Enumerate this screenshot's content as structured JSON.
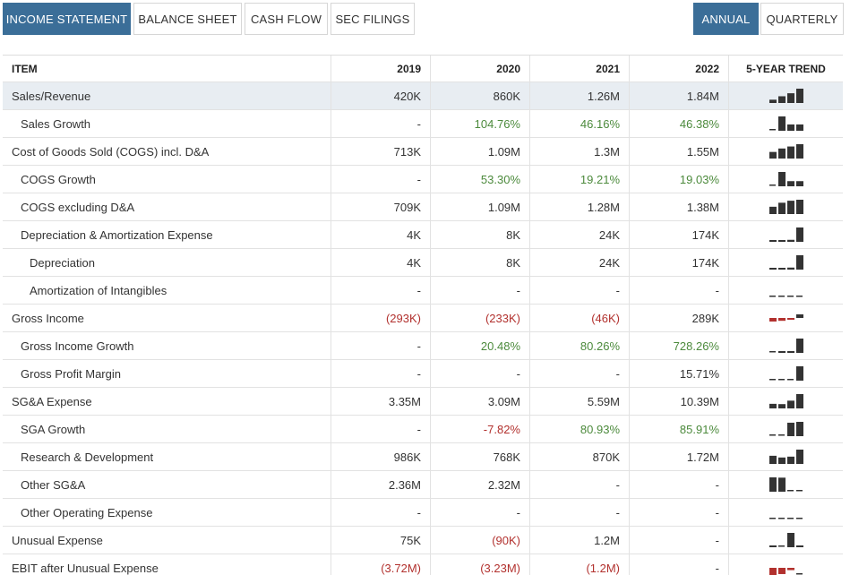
{
  "tabs": [
    {
      "label": "INCOME STATEMENT",
      "active": true
    },
    {
      "label": "BALANCE SHEET",
      "active": false
    },
    {
      "label": "CASH FLOW",
      "active": false
    },
    {
      "label": "SEC FILINGS",
      "active": false
    }
  ],
  "period_tabs": [
    {
      "label": "ANNUAL",
      "active": true
    },
    {
      "label": "QUARTERLY",
      "active": false
    }
  ],
  "table": {
    "header": [
      "ITEM",
      "2019",
      "2020",
      "2021",
      "2022",
      "5-YEAR TREND"
    ],
    "rows": [
      {
        "label": "Sales/Revenue",
        "indent": 0,
        "values": [
          "420K",
          "860K",
          "1.26M",
          "1.84M"
        ],
        "tone": [
          "",
          "",
          "",
          ""
        ],
        "trend": [
          0.23,
          0.47,
          0.68,
          1.0
        ]
      },
      {
        "label": "Sales Growth",
        "indent": 1,
        "values": [
          "-",
          "104.76%",
          "46.16%",
          "46.38%"
        ],
        "tone": [
          "",
          "pos",
          "pos",
          "pos"
        ],
        "trend": [
          0,
          1.0,
          0.44,
          0.44
        ]
      },
      {
        "label": "Cost of Goods Sold (COGS) incl. D&A",
        "indent": 0,
        "values": [
          "713K",
          "1.09M",
          "1.3M",
          "1.55M"
        ],
        "tone": [
          "",
          "",
          "",
          ""
        ],
        "trend": [
          0.46,
          0.7,
          0.84,
          1.0
        ]
      },
      {
        "label": "COGS Growth",
        "indent": 1,
        "values": [
          "-",
          "53.30%",
          "19.21%",
          "19.03%"
        ],
        "tone": [
          "",
          "pos",
          "pos",
          "pos"
        ],
        "trend": [
          0,
          1.0,
          0.36,
          0.36
        ]
      },
      {
        "label": "COGS excluding D&A",
        "indent": 1,
        "values": [
          "709K",
          "1.09M",
          "1.28M",
          "1.38M"
        ],
        "tone": [
          "",
          "",
          "",
          ""
        ],
        "trend": [
          0.51,
          0.79,
          0.93,
          1.0
        ]
      },
      {
        "label": "Depreciation & Amortization Expense",
        "indent": 1,
        "values": [
          "4K",
          "8K",
          "24K",
          "174K"
        ],
        "tone": [
          "",
          "",
          "",
          ""
        ],
        "trend": [
          0.02,
          0.05,
          0.14,
          1.0
        ]
      },
      {
        "label": "Depreciation",
        "indent": 2,
        "values": [
          "4K",
          "8K",
          "24K",
          "174K"
        ],
        "tone": [
          "",
          "",
          "",
          ""
        ],
        "trend": [
          0.02,
          0.05,
          0.14,
          1.0
        ]
      },
      {
        "label": "Amortization of Intangibles",
        "indent": 2,
        "values": [
          "-",
          "-",
          "-",
          "-"
        ],
        "tone": [
          "",
          "",
          "",
          ""
        ],
        "trend": [
          0,
          0,
          0,
          0
        ]
      },
      {
        "label": "Gross Income",
        "indent": 0,
        "values": [
          "(293K)",
          "(233K)",
          "(46K)",
          "289K"
        ],
        "tone": [
          "neg",
          "neg",
          "neg",
          ""
        ],
        "trend": [
          -0.5,
          -0.4,
          -0.1,
          0.5
        ]
      },
      {
        "label": "Gross Income Growth",
        "indent": 1,
        "values": [
          "-",
          "20.48%",
          "80.26%",
          "728.26%"
        ],
        "tone": [
          "",
          "pos",
          "pos",
          "pos"
        ],
        "trend": [
          0,
          0.03,
          0.11,
          1.0
        ]
      },
      {
        "label": "Gross Profit Margin",
        "indent": 1,
        "values": [
          "-",
          "-",
          "-",
          "15.71%"
        ],
        "tone": [
          "",
          "",
          "",
          ""
        ],
        "trend": [
          0,
          0,
          0,
          1.0
        ]
      },
      {
        "label": "SG&A Expense",
        "indent": 0,
        "values": [
          "3.35M",
          "3.09M",
          "5.59M",
          "10.39M"
        ],
        "tone": [
          "",
          "",
          "",
          ""
        ],
        "trend": [
          0.32,
          0.3,
          0.54,
          1.0
        ]
      },
      {
        "label": "SGA Growth",
        "indent": 1,
        "values": [
          "-",
          "-7.82%",
          "80.93%",
          "85.91%"
        ],
        "tone": [
          "",
          "neg",
          "pos",
          "pos"
        ],
        "trend": [
          0,
          0,
          0.94,
          1.0
        ]
      },
      {
        "label": "Research & Development",
        "indent": 1,
        "values": [
          "986K",
          "768K",
          "870K",
          "1.72M"
        ],
        "tone": [
          "",
          "",
          "",
          ""
        ],
        "trend": [
          0.57,
          0.45,
          0.51,
          1.0
        ]
      },
      {
        "label": "Other SG&A",
        "indent": 1,
        "values": [
          "2.36M",
          "2.32M",
          "-",
          "-"
        ],
        "tone": [
          "",
          "",
          "",
          ""
        ],
        "trend": [
          1.0,
          0.98,
          0,
          0
        ]
      },
      {
        "label": "Other Operating Expense",
        "indent": 1,
        "values": [
          "-",
          "-",
          "-",
          "-"
        ],
        "tone": [
          "",
          "",
          "",
          ""
        ],
        "trend": [
          0,
          0,
          0,
          0
        ]
      },
      {
        "label": "Unusual Expense",
        "indent": 0,
        "values": [
          "75K",
          "(90K)",
          "1.2M",
          "-"
        ],
        "tone": [
          "",
          "neg",
          "",
          ""
        ],
        "trend": [
          0.06,
          0,
          1.0,
          0.06
        ]
      },
      {
        "label": "EBIT after Unusual Expense",
        "indent": 0,
        "values": [
          "(3.72M)",
          "(3.23M)",
          "(1.2M)",
          "-"
        ],
        "tone": [
          "neg",
          "neg",
          "neg",
          ""
        ],
        "trend": [
          -1.0,
          -0.87,
          -0.32,
          0
        ]
      }
    ]
  },
  "colors": {
    "accent": "#3b6e98",
    "positive": "#4c8a3c",
    "negative": "#b2312e",
    "spark_bar": "#333333",
    "spark_neg_bar": "#b2312e",
    "highlight_row": "#e8edf2"
  }
}
